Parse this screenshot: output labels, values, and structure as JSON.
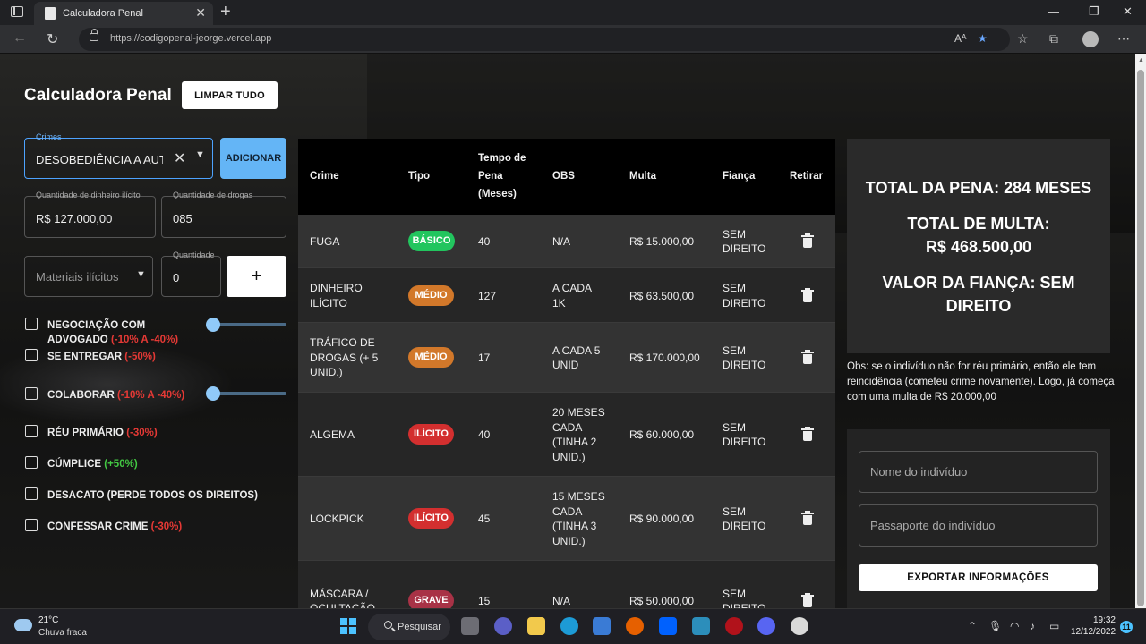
{
  "browser": {
    "tab_title": "Calculadora Penal",
    "url": "https://codigopenal-jeorge.vercel.app"
  },
  "app": {
    "title": "Calculadora Penal",
    "clear_button": "LIMPAR TUDO"
  },
  "form": {
    "crimes_label": "Crimes",
    "crimes_value": "DESOBEDIÊNCIA A AUTORIDADE",
    "add_button": "ADICIONAR",
    "money_label": "Quantidade de dinheiro ilícito",
    "money_value": "R$ 127.000,00",
    "drugs_label": "Quantidade de drogas",
    "drugs_value": "085",
    "materials_placeholder": "Materiais ilícitos",
    "qty_label": "Quantidade",
    "qty_value": "0",
    "plus_button": "+"
  },
  "options": [
    {
      "label": "NEGOCIAÇÃO COM",
      "label2": "ADVOGADO",
      "modifier": "(-10% A -40%)",
      "modifier_color": "red"
    },
    {
      "label": "SE ENTREGAR",
      "modifier": "(-50%)",
      "modifier_color": "red"
    },
    {
      "label": "COLABORAR",
      "modifier": "(-10% A -40%)",
      "modifier_color": "red"
    },
    {
      "label": "RÉU PRIMÁRIO",
      "modifier": "(-30%)",
      "modifier_color": "red"
    },
    {
      "label": "CÚMPLICE",
      "modifier": "(+50%)",
      "modifier_color": "green"
    },
    {
      "label": "DESACATO (PERDE TODOS OS DIREITOS)",
      "modifier": "",
      "modifier_color": "red"
    },
    {
      "label": "CONFESSAR CRIME",
      "modifier": "(-30%)",
      "modifier_color": "red"
    }
  ],
  "table": {
    "headers": {
      "crime": "Crime",
      "tipo": "Tipo",
      "tempo": [
        "Tempo de",
        "Pena",
        "(Meses)"
      ],
      "obs": "OBS",
      "multa": "Multa",
      "fianca": "Fiança",
      "retirar": "Retirar"
    },
    "rows": [
      {
        "crime": [
          "FUGA"
        ],
        "tipo": "BÁSICO",
        "tempo": "40",
        "obs": [
          "N/A"
        ],
        "multa": "R$ 15.000,00",
        "fianca": [
          "SEM",
          "DIREITO"
        ]
      },
      {
        "crime": [
          "DINHEIRO",
          "ILÍCITO"
        ],
        "tipo": "MÉDIO",
        "tempo": "127",
        "obs": [
          "A CADA",
          "1K"
        ],
        "multa": "R$ 63.500,00",
        "fianca": [
          "SEM",
          "DIREITO"
        ]
      },
      {
        "crime": [
          "TRÁFICO DE",
          "DROGAS (+ 5",
          "UNID.)"
        ],
        "tipo": "MÉDIO",
        "tempo": "17",
        "obs": [
          "A CADA 5",
          "UNID"
        ],
        "multa": "R$ 170.000,00",
        "fianca": [
          "SEM",
          "DIREITO"
        ]
      },
      {
        "crime": [
          "ALGEMA"
        ],
        "tipo": "ILÍCITO",
        "tempo": "40",
        "obs": [
          "20 MESES",
          "CADA",
          "(TINHA 2",
          "UNID.)"
        ],
        "multa": "R$ 60.000,00",
        "fianca": [
          "SEM",
          "DIREITO"
        ]
      },
      {
        "crime": [
          "LOCKPICK"
        ],
        "tipo": "ILÍCITO",
        "tempo": "45",
        "obs": [
          "15 MESES",
          "CADA",
          "(TINHA 3",
          "UNID.)"
        ],
        "multa": "R$ 90.000,00",
        "fianca": [
          "SEM",
          "DIREITO"
        ]
      },
      {
        "crime": [
          "MÁSCARA /",
          "OCULTAÇÃO"
        ],
        "tipo": "GRAVE",
        "tempo": "15",
        "obs": [
          "N/A"
        ],
        "multa": "R$ 50.000,00",
        "fianca": [
          "SEM",
          "DIREITO"
        ]
      }
    ],
    "badge_colors": {
      "BÁSICO": "#22c55e",
      "MÉDIO": "#d2782a",
      "ILÍCITO": "#d32f2f",
      "GRAVE": "#a83246"
    }
  },
  "summary": {
    "total_pena": "TOTAL DA PENA: 284 MESES",
    "total_multa_label": "TOTAL DE MULTA:",
    "total_multa_value": "R$ 468.500,00",
    "fianca_line1": "VALOR DA FIANÇA: SEM",
    "fianca_line2": "DIREITO",
    "note": "Obs: se o indivíduo não for réu primário, então ele tem reincidência (cometeu crime novamente). Logo, já começa com uma multa de R$ 20.000,00"
  },
  "export": {
    "name_placeholder": "Nome do indivíduo",
    "passport_placeholder": "Passaporte do indivíduo",
    "button": "EXPORTAR INFORMAÇÕES"
  },
  "taskbar": {
    "temperature": "21°C",
    "weather": "Chuva fraca",
    "search": "Pesquisar",
    "time": "19:32",
    "date": "12/12/2022",
    "notifications": "11"
  }
}
